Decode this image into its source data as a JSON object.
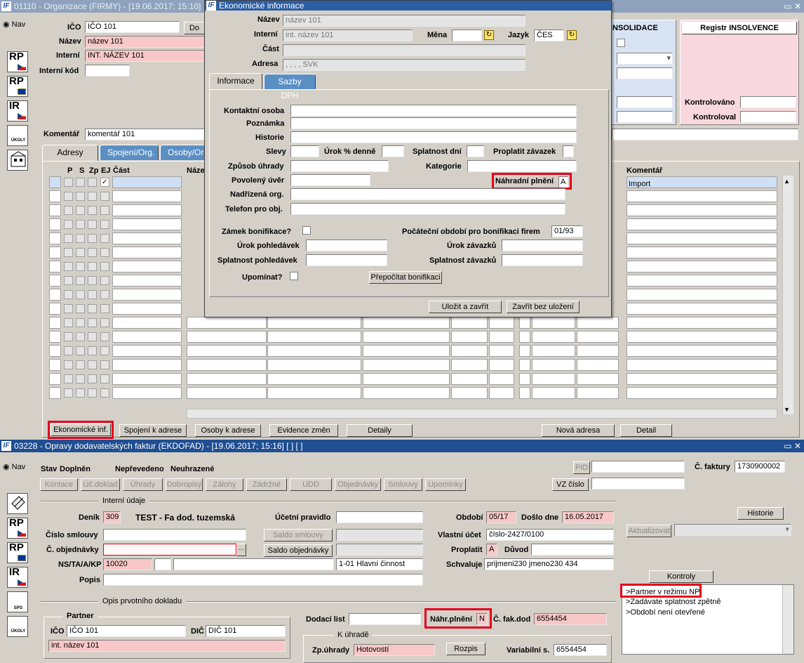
{
  "top_window": {
    "title": "01110 - Organizace (FIRMY) - [19.06.2017; 15:10]",
    "nav_label": "Nav",
    "side_icons": [
      {
        "text": "RP",
        "flag": "cz"
      },
      {
        "text": "RP",
        "flag": "eu"
      },
      {
        "text": "IR",
        "flag": "cz"
      },
      {
        "text": "ÚKOLY",
        "flag": ""
      },
      {
        "text": "",
        "flag": ""
      }
    ],
    "fields": {
      "ico_label": "IČO",
      "ico_value": "IČO 101",
      "do_button": "Do",
      "nazev_label": "Název",
      "nazev_value": "název 101",
      "interni_label": "Interní",
      "interni_value": "INT. NÁZEV 101",
      "interni_kod_label": "Interní kód",
      "interni_kod_value": "",
      "komentar_label": "Komentář",
      "komentar_value": "komentář 101"
    },
    "konsolidace_title": "NSOLIDACE",
    "insolvence": {
      "title": "Registr INSOLVENCE",
      "kontrolovano_label": "Kontrolováno",
      "kontroloval_label": "Kontroloval"
    },
    "tabs": [
      "Adresy",
      "Spojení/Org.",
      "Osoby/Org"
    ],
    "grid": {
      "headers": [
        "P",
        "S",
        "Zp",
        "EJ",
        "Část",
        "Náze"
      ],
      "right_header": "Komentář",
      "first_row_comment": "Import"
    },
    "bottom_buttons": {
      "ekonomicke": "Ekonomické inf.",
      "spojeni": "Spojení k adrese",
      "osoby": "Osoby k adrese",
      "evidence": "Evidence změn",
      "detaily": "Detaily",
      "nova_adresa": "Nová adresa",
      "detail": "Detail"
    }
  },
  "dialog": {
    "title": "Ekonomické informace",
    "nazev_label": "Název",
    "nazev_value": "název 101",
    "interni_label": "Interní",
    "interni_value": "int. název 101",
    "mena_label": "Měna",
    "mena_value": "",
    "jazyk_label": "Jazyk",
    "jazyk_value": "ČES",
    "cast_label": "Část",
    "cast_value": "",
    "adresa_label": "Adresa",
    "adresa_value": ", , , , SVK",
    "tabs": [
      "Informace",
      "Sazby DPH"
    ],
    "labels": {
      "kontaktni_osoba": "Kontaktní osoba",
      "poznamka": "Poznámka",
      "historie": "Historie",
      "slevy": "Slevy",
      "urok_denne": "Úrok % denně",
      "splatnost_dni": "Splatnost dní",
      "proplatit": "Proplatit závazek",
      "zpusob_uhrady": "Způsob úhrady",
      "kategorie": "Kategorie",
      "povoleny_uver": "Povolený úvěr",
      "nahradni_plneni": "Náhradní plnění",
      "nadrizena_org": "Nadřízená org.",
      "telefon": "Telefon pro obj.",
      "zamek": "Zámek bonifikace?",
      "pocatecni": "Počáteční období pro bonifikaci firem",
      "urok_pohledavek": "Úrok pohledávek",
      "urok_zavazku": "Úrok závazků",
      "splatnost_pohledavek": "Splatnost pohledávek",
      "splatnost_zavazku": "Splatnost závazků",
      "upominat": "Upomínat?"
    },
    "nahradni_plneni_value": "A",
    "pocatecni_value": "01/93",
    "prepocitat_button": "Přepočítat bonifikaci",
    "ulozit_button": "Uložit a zavřít",
    "zavrit_button": "Zavřít bez uložení"
  },
  "bottom_window": {
    "title": "03228 - Opravy dodavatelských faktur (EKDOFAD) - [19.06.2017; 15:16]  [ ]  [ ]",
    "nav_label": "Nav",
    "side_icons": [
      {
        "text": "",
        "flag": ""
      },
      {
        "text": "RP",
        "flag": "cz"
      },
      {
        "text": "RP",
        "flag": "eu"
      },
      {
        "text": "IR",
        "flag": "cz"
      },
      {
        "text": "SPG",
        "flag": ""
      },
      {
        "text": "ÚKOLY",
        "flag": ""
      }
    ],
    "stav_label": "Stav",
    "stav_values": [
      "Doplněn",
      "Nepřevedeno",
      "Neuhrazené"
    ],
    "pid_label": "PID",
    "c_faktury_label": "Č. faktury",
    "c_faktury_value": "1730900002",
    "vz_cislo_label": "VZ číslo",
    "toolbar": [
      "Kontace",
      "Úč.doklad",
      "Úhrady",
      "Dobropisy",
      "Zálohy",
      "Zádržné",
      "UDD",
      "Objednávky",
      "Smlouvy",
      "Upomínky"
    ],
    "interni_udaje": "Interní údaje",
    "denik_label": "Deník",
    "denik_value": "309",
    "denik_name": "TEST - Fa dod. tuzemská",
    "ucetni_pravidlo_label": "Účetní pravidlo",
    "obdobi_label": "Období",
    "obdobi_value": "05/17",
    "doslo_label": "Došlo dne",
    "doslo_value": "16.05.2017",
    "historie_button": "Historie",
    "cislo_smlouvy_label": "Číslo smlouvy",
    "saldo_smlouvy": "Saldo smlouvy",
    "vlastni_ucet_label": "Vlastní účet",
    "vlastni_ucet_value": "číslo-2427/0100",
    "aktualizovat": "Aktualizovat",
    "c_objednavky_label": "Č. objednávky",
    "saldo_objednavky": "Saldo objednávky",
    "proplatit_label": "Proplatit",
    "proplatit_value": "A",
    "duvod_label": "Důvod",
    "ns_label": "NS/TA/A/KP",
    "ns_value": "10020",
    "ns_desc": "1-01 Hlavní činnost",
    "schvaluje_label": "Schvaluje",
    "schvaluje_value": "prijmeni230 jmeno230 434",
    "popis_label": "Popis",
    "kontroly_title": "Kontroly",
    "kontroly_lines": [
      ">Partner v režimu NP",
      ">Zadávate splatnost zpětně",
      ">Období není otevřené"
    ],
    "opis_label": "Opis prvotního dokladu",
    "partner_label": "Partner",
    "ico_label": "IČO",
    "ico_value": "IČO 101",
    "dic_label": "DIČ",
    "dic_value": "DIČ 101",
    "int_nazev_value": "int. název 101",
    "dodaci_list_label": "Dodací list",
    "nahr_plneni_label": "Náhr.plnění",
    "nahr_plneni_value": "N",
    "c_fak_dod_label": "Č. fak.dod",
    "c_fak_dod_value": "6554454",
    "k_uhrade_label": "K úhradě",
    "zp_uhrady_label": "Zp.úhrady",
    "zp_uhrady_value": "Hotovostí",
    "rozpis_button": "Rozpis",
    "variabilni_label": "Variabilní s.",
    "variabilni_value": "6554454"
  },
  "colors": {
    "highlight": "#e3001b",
    "pink": "#f8c8c8",
    "titlebar": "#3a6ea5"
  }
}
